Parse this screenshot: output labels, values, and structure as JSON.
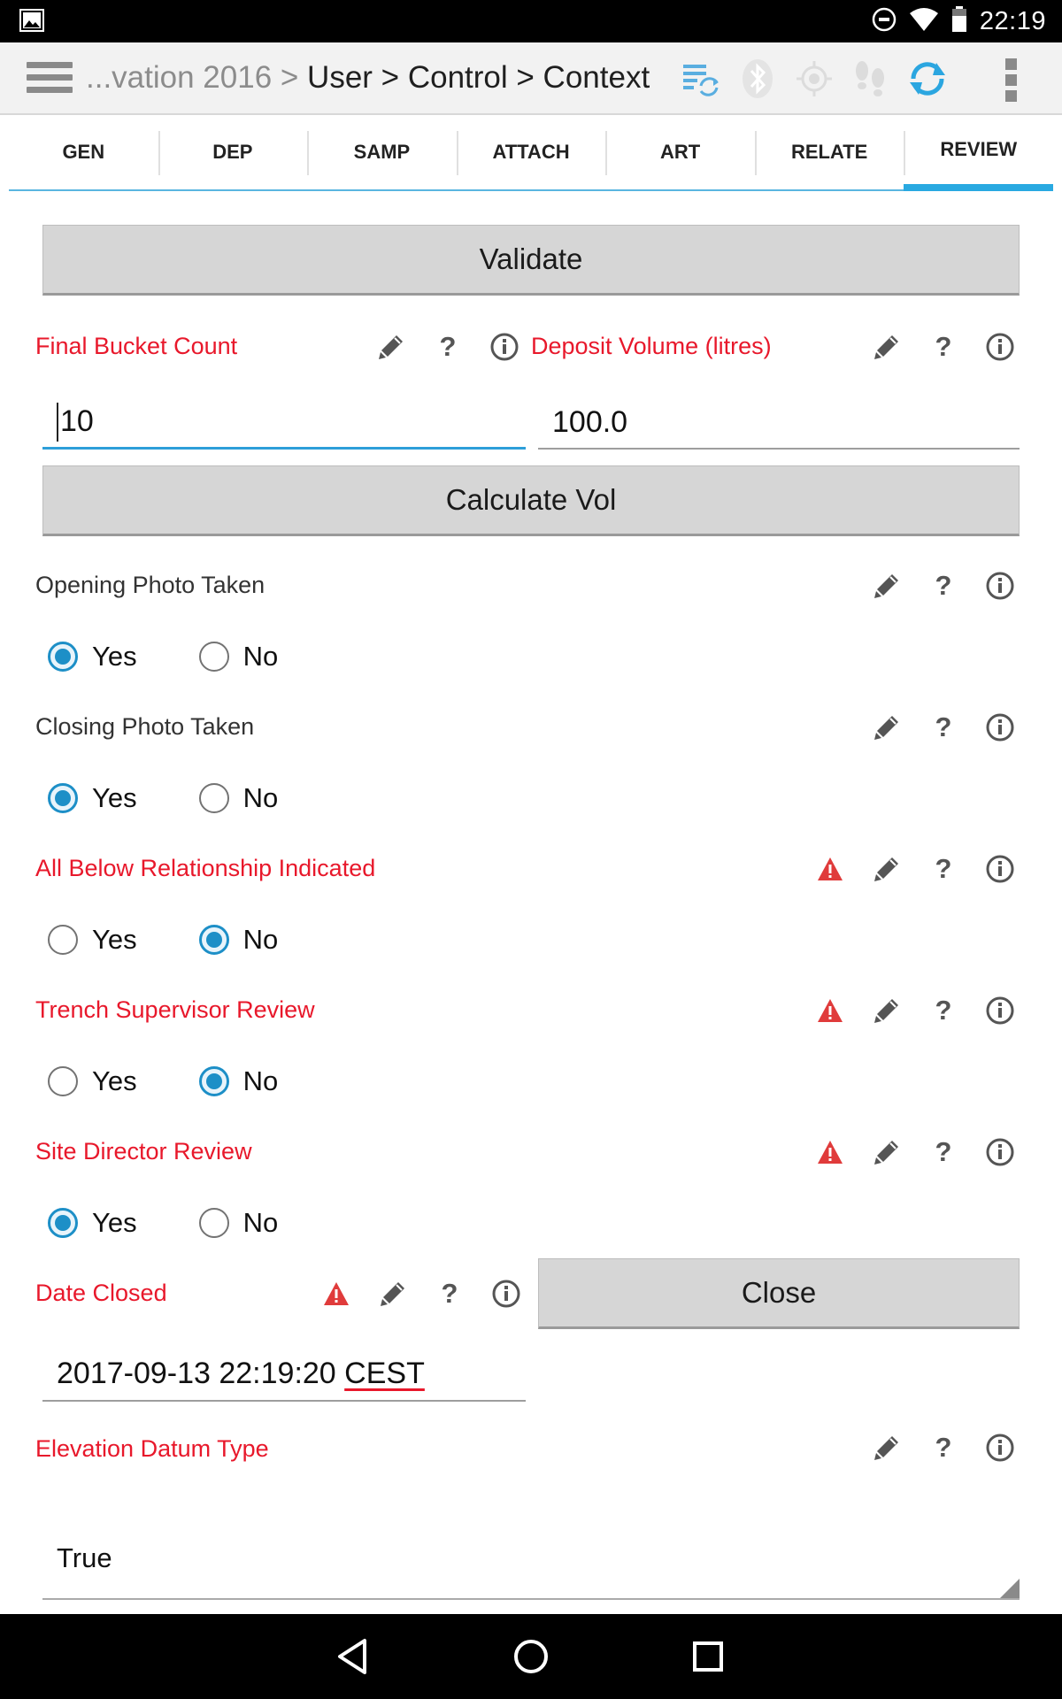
{
  "status_bar": {
    "time": "22:19",
    "icons": [
      "gallery-icon",
      "dnd-icon",
      "wifi-icon",
      "battery-icon"
    ]
  },
  "action_bar": {
    "breadcrumb_prefix": "...vation 2016 > ",
    "breadcrumb_path": "User > Control > Context",
    "icons": [
      "sync-list-icon",
      "bluetooth-icon",
      "gps-icon",
      "tracking-icon",
      "refresh-icon",
      "overflow-menu-icon"
    ]
  },
  "tabs": [
    {
      "label": "GEN",
      "active": false
    },
    {
      "label": "DEP",
      "active": false
    },
    {
      "label": "SAMP",
      "active": false
    },
    {
      "label": "ATTACH",
      "active": false
    },
    {
      "label": "ART",
      "active": false
    },
    {
      "label": "RELATE",
      "active": false
    },
    {
      "label": "REVIEW",
      "active": true
    }
  ],
  "form": {
    "validate_label": "Validate",
    "final_bucket_count": {
      "label": "Final Bucket Count",
      "value": "10"
    },
    "deposit_volume": {
      "label": "Deposit Volume (litres)",
      "value": "100.0"
    },
    "calculate_label": "Calculate Vol",
    "opening_photo": {
      "label": "Opening Photo Taken",
      "selected": "Yes"
    },
    "closing_photo": {
      "label": "Closing Photo Taken",
      "selected": "Yes"
    },
    "all_below": {
      "label": "All Below Relationship Indicated",
      "selected": "No"
    },
    "trench_supervisor": {
      "label": "Trench Supervisor Review",
      "selected": "No"
    },
    "site_director": {
      "label": "Site Director Review",
      "selected": "Yes"
    },
    "date_closed": {
      "label": "Date Closed",
      "value_main": "2017-09-13 22:19:20 ",
      "value_tz": "CEST"
    },
    "close_label": "Close",
    "elevation_datum": {
      "label": "Elevation Datum Type",
      "value": "True"
    },
    "yes_label": "Yes",
    "no_label": "No",
    "help_glyph": "?"
  },
  "colors": {
    "required_label": "#e8182b",
    "accent": "#29a9e1",
    "warning": "#e03b3b"
  }
}
